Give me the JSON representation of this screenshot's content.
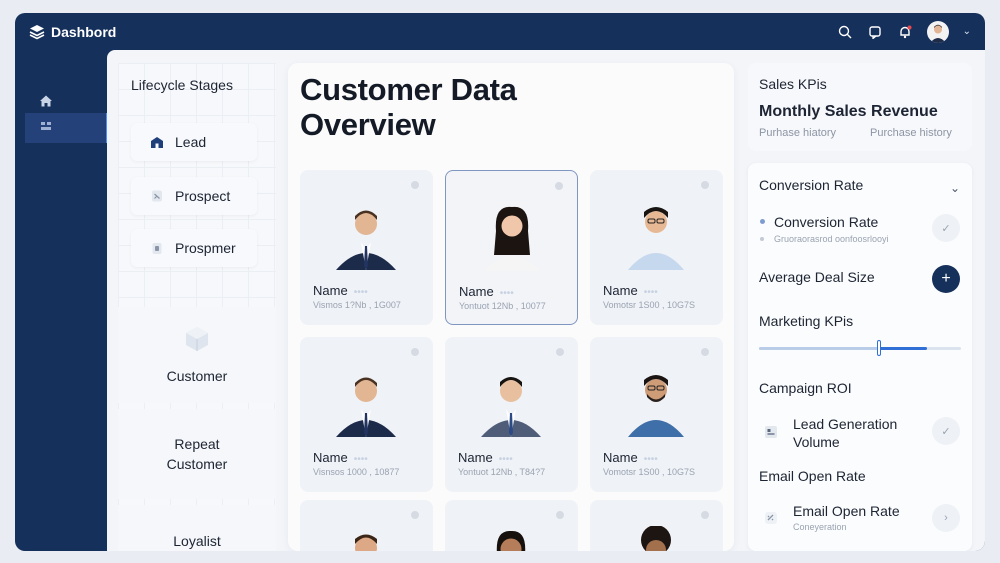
{
  "brand": {
    "title": "Dashbord"
  },
  "lifecycle": {
    "title": "Lifecycle Stages",
    "stages": [
      {
        "label": "Lead",
        "icon": "building-icon"
      },
      {
        "label": "Prospect",
        "icon": "document-icon"
      },
      {
        "label": "Prospmer",
        "icon": "clipboard-icon"
      }
    ],
    "big_stages": [
      {
        "label": "Customer",
        "icon": "cube-icon"
      },
      {
        "label_line1": "Repeat",
        "label_line2": "Customer"
      },
      {
        "label": "Loyalist"
      }
    ]
  },
  "main": {
    "title_line1": "Customer Data",
    "title_line2": "Overview",
    "cards": [
      {
        "name": "Name",
        "meta": "Vismos 1?Nb , 1G007"
      },
      {
        "name": "Name",
        "meta": "Yontuot 12Nb , 10077"
      },
      {
        "name": "Name",
        "meta": "Vomotsr 1S00 , 10G7S"
      },
      {
        "name": "Name",
        "meta": "Visnsos 1000 , 10877"
      },
      {
        "name": "Name",
        "meta": "Yontuot 12Nb , T84?7"
      },
      {
        "name": "Name",
        "meta": "Vomotsr 1S00 , 10G7S"
      },
      {
        "name": "",
        "meta": ""
      },
      {
        "name": "",
        "meta": ""
      },
      {
        "name": "",
        "meta": ""
      }
    ]
  },
  "kpi_top": {
    "title": "Sales KPis",
    "subtitle": "Monthly Sales Revenue",
    "col1": "Purhase hiatory",
    "col2": "Purchase history"
  },
  "kpi": {
    "conversion_rate_title": "Conversion Rate",
    "conversion_rate_item": "Conversion Rate",
    "conversion_rate_sub": "Gruoraorasrod oonfoosrlooyi",
    "average_deal_size": "Average Deal Size",
    "marketing_kpis": "Marketing KPis",
    "marketing_slider_value": 0.6,
    "campaign_roi": "Campaign ROI",
    "lead_generation_line1": "Lead Generation",
    "lead_generation_line2": "Volume",
    "email_open_rate_title": "Email Open Rate",
    "email_open_rate_item": "Email Open Rate",
    "email_open_rate_sub": "Coneyeration"
  },
  "colors": {
    "sidebar": "#16305c",
    "accent": "#2f6fd6",
    "content_bg": "#f3f5f9"
  }
}
